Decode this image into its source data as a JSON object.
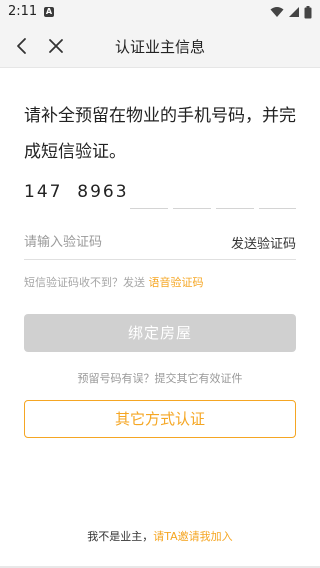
{
  "status_bar": {
    "time": "2:11",
    "notification_icon": "A",
    "icons": [
      "wifi-icon",
      "signal-icon",
      "battery-icon"
    ]
  },
  "nav": {
    "title": "认证业主信息",
    "back_icon": "chevron-left-icon",
    "close_icon": "close-icon"
  },
  "headline": "请补全预留在物业的手机号码，并完成短信验证。",
  "phone": {
    "value": "147  8963",
    "missing_slots": 4
  },
  "code": {
    "placeholder": "请输入验证码",
    "send_label": "发送验证码"
  },
  "hint": {
    "text": "短信验证码收不到？发送 ",
    "link": "语音验证码"
  },
  "bind_button": {
    "label": "绑定房屋",
    "enabled": false
  },
  "alt_hint": "预留号码有误？提交其它有效证件",
  "other_button": {
    "label": "其它方式认证"
  },
  "footer": {
    "text": "我不是业主，",
    "link": "请TA邀请我加入"
  },
  "colors": {
    "accent": "#f5a623",
    "disabled": "#d0d0d0",
    "header_bg": "#f4f4f4"
  }
}
